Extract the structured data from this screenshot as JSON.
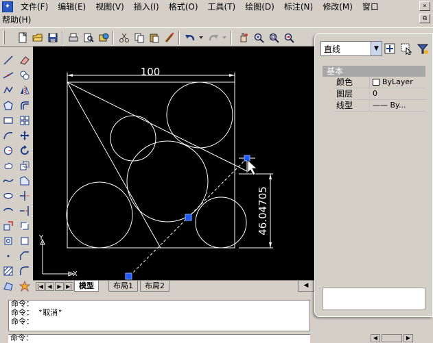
{
  "app": {
    "icon_char": "✦"
  },
  "menu": {
    "items": [
      "文件(F)",
      "编辑(E)",
      "视图(V)",
      "插入(I)",
      "格式(O)",
      "工具(T)",
      "绘图(D)",
      "标注(N)",
      "修改(M)",
      "窗口"
    ],
    "second_row": [
      "帮助(H)"
    ]
  },
  "window_controls": {
    "close": "×",
    "restore": "⧉"
  },
  "drawing": {
    "dim_horizontal": "100",
    "dim_vertical": "46.04705",
    "ucs_y": "Y",
    "ucs_x": "X",
    "colors": {
      "background": "#000000",
      "lines": "#ffffff",
      "grip": "#1e5cff",
      "grip_outline": "#7fa8ff"
    }
  },
  "layout_tabs": [
    "模型",
    "布局1",
    "布局2"
  ],
  "tab_nav": [
    "|◀",
    "◀",
    "▶",
    "▶|"
  ],
  "command": {
    "lines": [
      "命令：",
      "命令：  *取消*",
      "命令："
    ],
    "prompt": "命令："
  },
  "properties": {
    "object_type": "直线",
    "category": "基本",
    "rows": [
      {
        "name": "颜色",
        "value": "ByLayer",
        "swatch": true
      },
      {
        "name": "图层",
        "value": "0",
        "swatch": false
      },
      {
        "name": "线型",
        "value": "—— By...",
        "swatch": false
      }
    ]
  }
}
